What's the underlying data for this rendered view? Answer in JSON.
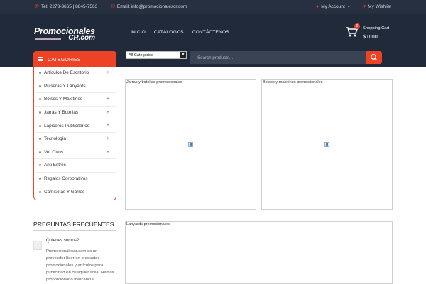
{
  "topbar": {
    "phone": "Tel: 2273-3665 | 8845-7563",
    "email": "Email: info@promocionalescr.com",
    "account": "My Account",
    "wishlist": "My Wishlist"
  },
  "header": {
    "logo_line1": "Promocionales",
    "logo_line2": "CR.com",
    "nav": [
      "INICIO",
      "CATÁLOGOS",
      "CONTÁCTENOS"
    ],
    "cart_count": "0",
    "cart_label": "Shopping Cart",
    "cart_total": "$ 0.00"
  },
  "search": {
    "category_selected": "All Categories",
    "placeholder": "Search products..."
  },
  "categories": {
    "title": "CATEGORIES",
    "items": [
      {
        "label": "Artículos De Escritorio",
        "has_children": true
      },
      {
        "label": "Pulseras Y Lanyards",
        "has_children": false
      },
      {
        "label": "Bolsos Y Maletines",
        "has_children": true
      },
      {
        "label": "Jarras Y Botellas",
        "has_children": true
      },
      {
        "label": "Lapiceros Publicitarios",
        "has_children": true
      },
      {
        "label": "Tecnología",
        "has_children": true
      },
      {
        "label": "Ver Otros",
        "has_children": true
      },
      {
        "label": "Anti Estrés",
        "has_children": false
      },
      {
        "label": "Regalos Corporativos",
        "has_children": false
      },
      {
        "label": "Camisetas Y Gorras",
        "has_children": false
      }
    ]
  },
  "faq": {
    "title": "PREGUNTAS FRECUENTES",
    "toggle": "-",
    "question": "Quienes somos?",
    "answer": "Promocionalescr.com es un proveedor líder en productos promocionales y artículos para publicidad en cualquier área. Hemos proporcionado mercancía"
  },
  "products": {
    "box1_title": "Jarras y botellas promocionales",
    "box2_title": "Bolsos y maletines promocionales",
    "box3_title": "Lanyards promocionales"
  },
  "colors": {
    "accent": "#ed4225",
    "header_bg": "#212a3b",
    "topbar_bg": "#273040"
  }
}
